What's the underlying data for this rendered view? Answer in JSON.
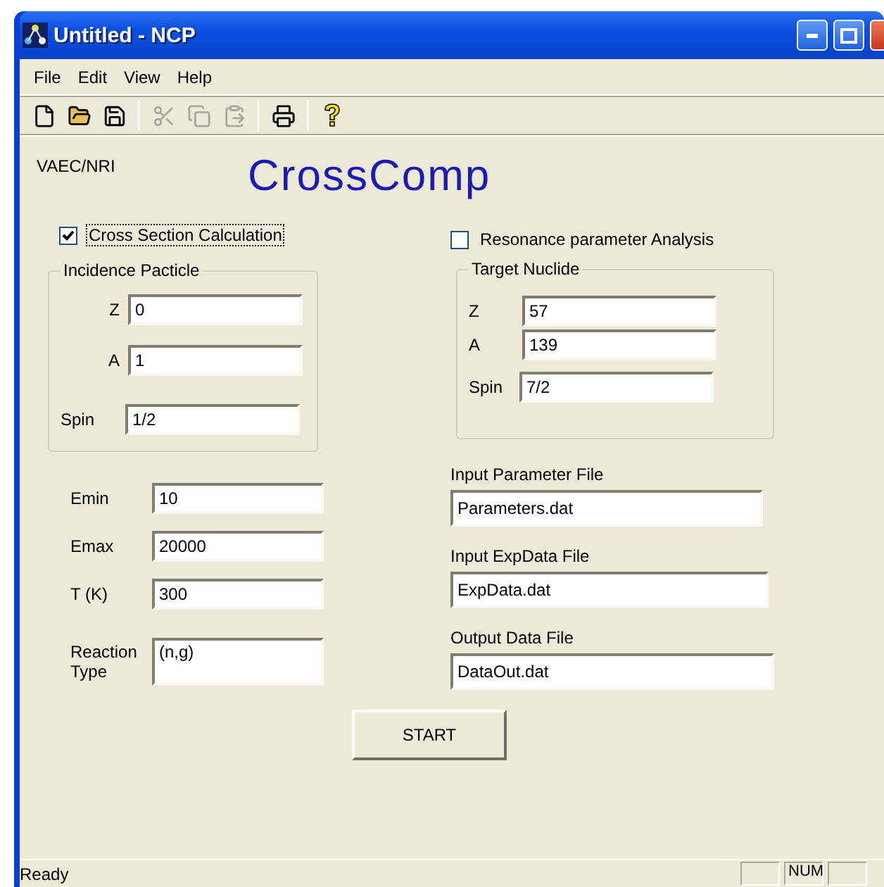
{
  "window": {
    "title": "Untitled - NCP"
  },
  "menu": [
    "File",
    "Edit",
    "View",
    "Help"
  ],
  "toolbar": [
    {
      "kind": "new",
      "disabled": false
    },
    {
      "kind": "open",
      "disabled": false
    },
    {
      "kind": "save",
      "disabled": false
    },
    {
      "kind": "separator"
    },
    {
      "kind": "cut",
      "disabled": true
    },
    {
      "kind": "copy",
      "disabled": true
    },
    {
      "kind": "paste",
      "disabled": true
    },
    {
      "kind": "separator"
    },
    {
      "kind": "print",
      "disabled": false
    },
    {
      "kind": "separator"
    },
    {
      "kind": "help",
      "disabled": false
    }
  ],
  "org": "VAEC/NRI",
  "app_title": "CrossComp",
  "cross_section": {
    "label": "Cross Section Calculation",
    "checked": true
  },
  "resonance": {
    "label": "Resonance parameter Analysis",
    "checked": false
  },
  "incidence": {
    "title": "Incidence Pacticle",
    "fields": [
      {
        "label": "Z",
        "value": "0"
      },
      {
        "label": "A",
        "value": "1"
      },
      {
        "label": "Spin",
        "value": "1/2"
      }
    ]
  },
  "target": {
    "title": "Target Nuclide",
    "fields": [
      {
        "label": "Z",
        "value": "57"
      },
      {
        "label": "A",
        "value": "139"
      },
      {
        "label": "Spin",
        "value": "7/2"
      }
    ]
  },
  "energy_fields": [
    {
      "label": "Emin",
      "value": "10"
    },
    {
      "label": "Emax",
      "value": "20000"
    },
    {
      "label": "T (K)",
      "value": "300"
    },
    {
      "label": "Reaction Type",
      "value": "(n,g)"
    }
  ],
  "files": [
    {
      "label": "Input Parameter File",
      "value": "Parameters.dat"
    },
    {
      "label": "Input ExpData File",
      "value": "ExpData.dat"
    },
    {
      "label": "Output Data File",
      "value": "DataOut.dat"
    }
  ],
  "start_button": "START",
  "status_bar": {
    "text": "Ready",
    "num_indicator": "NUM"
  }
}
